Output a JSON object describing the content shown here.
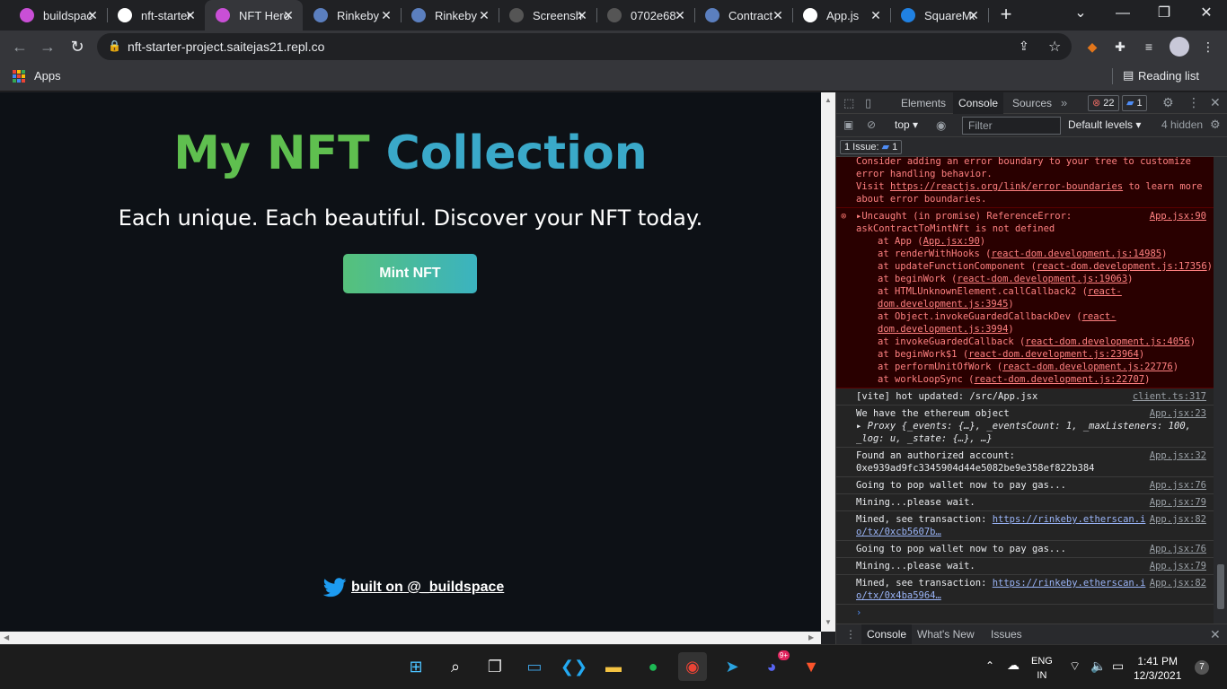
{
  "tabs": [
    {
      "label": "buildspace",
      "favicon": "unicorn-icon",
      "color": "#c94fd6"
    },
    {
      "label": "nft-starter",
      "favicon": "replit-icon",
      "color": "#ffffff"
    },
    {
      "label": "NFT Hero",
      "favicon": "unicorn-icon",
      "color": "#c94fd6",
      "active": true
    },
    {
      "label": "Rinkeby",
      "favicon": "etherscan-icon",
      "color": "#5b7fbf"
    },
    {
      "label": "Rinkeby",
      "favicon": "etherscan-icon",
      "color": "#5b7fbf"
    },
    {
      "label": "Screenshot",
      "favicon": "pinterest-icon",
      "color": "#555555"
    },
    {
      "label": "0702e68",
      "favicon": "pinterest-icon",
      "color": "#555555"
    },
    {
      "label": "Contract",
      "favicon": "etherscan-icon",
      "color": "#5b7fbf"
    },
    {
      "label": "App.js",
      "favicon": "github-icon",
      "color": "#ffffff"
    },
    {
      "label": "SquareMe",
      "favicon": "opensea-icon",
      "color": "#2081e2"
    }
  ],
  "toolbar": {
    "url": "nft-starter-project.saitejas21.repl.co"
  },
  "bookmarks": {
    "apps_label": "Apps",
    "reading_list": "Reading list"
  },
  "page": {
    "title_part1": "My NFT",
    "title_part2": "Collection",
    "subtitle": "Each unique. Each beautiful. Discover your NFT today.",
    "mint_button": "Mint NFT",
    "footer_link": "built on @_buildspace"
  },
  "devtools": {
    "tabs": [
      "Elements",
      "Console",
      "Sources"
    ],
    "active_tab": "Console",
    "error_count": "22",
    "message_count": "1",
    "context": "top",
    "filter_placeholder": "Filter",
    "levels": "Default levels",
    "hidden": "4 hidden",
    "issues": "1 Issue:",
    "issues_count": "1",
    "error_top": {
      "line1": "Consider adding an error boundary to your tree to customize",
      "line2": "error handling behavior.",
      "line3_prefix": "Visit ",
      "line3_link": "https://reactjs.org/link/error-boundaries",
      "line3_suffix": " to learn more",
      "line4": "about error boundaries."
    },
    "error_main": {
      "head": "▸Uncaught (in promise) ReferenceError:",
      "src": "App.jsx:90",
      "msg": "askContractToMintNft is not defined",
      "stack": [
        {
          "pre": "at App (",
          "link": "App.jsx:90",
          "post": ")"
        },
        {
          "pre": "at renderWithHooks (",
          "link": "react-dom.development.js:14985",
          "post": ")"
        },
        {
          "pre": "at updateFunctionComponent (",
          "link": "react-dom.development.js:17356",
          "post": ")"
        },
        {
          "pre": "at beginWork (",
          "link": "react-dom.development.js:19063",
          "post": ")"
        },
        {
          "pre": "at HTMLUnknownElement.callCallback2 (",
          "link": "react-dom.development.js:3945",
          "post": ")"
        },
        {
          "pre": "at Object.invokeGuardedCallbackDev (",
          "link": "react-dom.development.js:3994",
          "post": ")"
        },
        {
          "pre": "at invokeGuardedCallback (",
          "link": "react-dom.development.js:4056",
          "post": ")"
        },
        {
          "pre": "at beginWork$1 (",
          "link": "react-dom.development.js:23964",
          "post": ")"
        },
        {
          "pre": "at performUnitOfWork (",
          "link": "react-dom.development.js:22776",
          "post": ")"
        },
        {
          "pre": "at workLoopSync (",
          "link": "react-dom.development.js:22707",
          "post": ")"
        }
      ]
    },
    "logs": [
      {
        "text": "[vite] hot updated: /src/App.jsx",
        "src": "client.ts:317"
      },
      {
        "text": "We have the ethereum object",
        "src": "App.jsx:23",
        "extra": "▸ Proxy {_events: {…}, _eventsCount: 1, _maxListeners: 100, _log: u, _state: {…}, …}"
      },
      {
        "text": "Found an authorized account:",
        "src": "App.jsx:32",
        "extra": "0xe939ad9fc3345904d44e5082be9e358ef822b384"
      },
      {
        "text": "Going to pop wallet now to pay gas...",
        "src": "App.jsx:76"
      },
      {
        "text": "Mining...please wait.",
        "src": "App.jsx:79"
      },
      {
        "text": "Mined, see transaction: ",
        "src": "App.jsx:82",
        "link": "https://rinkeby.etherscan.io/tx/0xcb5607b…"
      },
      {
        "text": "Going to pop wallet now to pay gas...",
        "src": "App.jsx:76"
      },
      {
        "text": "Mining...please wait.",
        "src": "App.jsx:79"
      },
      {
        "text": "Mined, see transaction: ",
        "src": "App.jsx:82",
        "link": "https://rinkeby.etherscan.io/tx/0x4ba5964…"
      }
    ],
    "prompt": "›",
    "drawer_tabs": [
      "Console",
      "What's New",
      "Issues"
    ]
  },
  "taskbar": {
    "apps": [
      "start-icon",
      "search-icon",
      "task-view-icon",
      "monitor-icon",
      "vscode-icon",
      "file-explorer-icon",
      "spotify-icon",
      "chrome-icon",
      "telegram-icon",
      "discord-icon",
      "brave-icon"
    ],
    "discord_badge": "9+",
    "lang_line1": "ENG",
    "lang_line2": "IN",
    "time": "1:41 PM",
    "date": "12/3/2021",
    "notifications": "7"
  }
}
